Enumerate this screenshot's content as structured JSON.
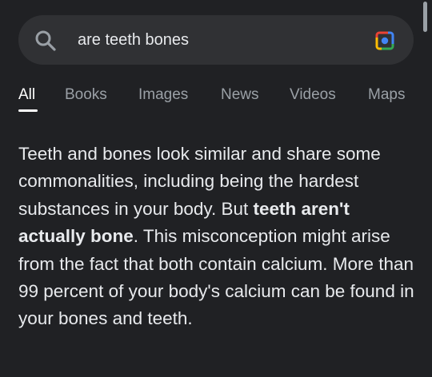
{
  "search": {
    "query": "are teeth bones",
    "icon": "search-icon",
    "lens_icon": "google-lens-icon"
  },
  "tabs": [
    {
      "label": "All",
      "active": true
    },
    {
      "label": "Books",
      "active": false
    },
    {
      "label": "Images",
      "active": false
    },
    {
      "label": "News",
      "active": false
    },
    {
      "label": "Videos",
      "active": false
    },
    {
      "label": "Maps",
      "active": false
    }
  ],
  "snippet": {
    "before_bold": "Teeth and bones look similar and share some commonalities, including being the hardest substances in your body. But ",
    "bold": "teeth aren't actually bone",
    "after_bold": ". This misconception might arise from the fact that both contain calcium. More than 99 percent of your body's calcium can be found in your bones and teeth."
  },
  "colors": {
    "background": "#202124",
    "search_bar": "#303134",
    "text": "#e8eaed",
    "muted": "#9aa0a6"
  }
}
